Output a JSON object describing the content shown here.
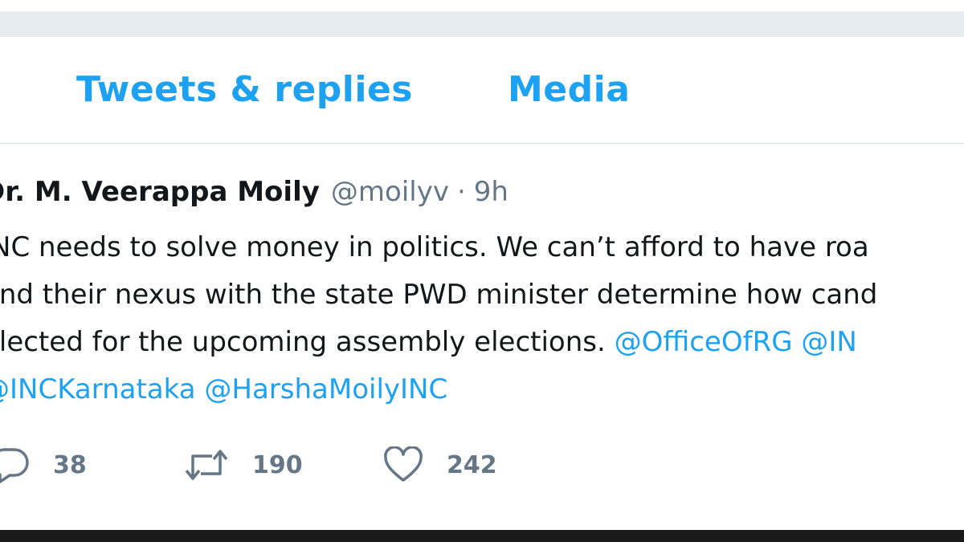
{
  "tabs": {
    "replies": "Tweets & replies",
    "media": "Media"
  },
  "tweet": {
    "author": "Dr. M. Veerappa Moily",
    "handle": "@moilyv",
    "separator": "·",
    "time": "9h",
    "line1": "INC needs to solve money in politics. We can’t afford to have roa",
    "line2": "and their nexus with the state PWD minister determine how cand",
    "line3_text": "elected for the upcoming assembly elections.",
    "mention_officeofrg": "@OfficeOfRG",
    "mention_in": "@IN",
    "mention_inckarnataka": "@INCKarnataka",
    "mention_harshamoilyinc": "@HarshaMoilyINC",
    "replies": "38",
    "retweets": "190",
    "likes": "242"
  },
  "icons": {
    "reply": "reply-icon",
    "retweet": "retweet-icon",
    "like": "heart-icon"
  },
  "colors": {
    "accent": "#1da1f2",
    "text": "#14171a",
    "muted": "#657786",
    "band": "#e6ecf0"
  }
}
